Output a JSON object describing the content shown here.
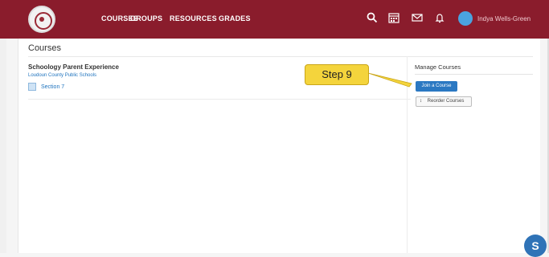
{
  "topbar": {
    "nav": [
      "COURSES",
      "GROUPS",
      "RESOURCES",
      "GRADES"
    ],
    "user_name": "Indya Wells-Green",
    "icons": [
      "search-icon",
      "calendar-icon",
      "mail-icon",
      "notifications-icon"
    ]
  },
  "page": {
    "title": "Courses"
  },
  "course": {
    "name": "Schoology Parent Experience",
    "school": "Loudoun County Public Schools",
    "section": "Section 7"
  },
  "manage": {
    "title": "Manage Courses",
    "join_label": "Join a Course",
    "reorder_label": "Reorder Courses"
  },
  "annotation": {
    "step_label": "Step 9"
  },
  "help_fab": {
    "label": "S"
  },
  "colors": {
    "brand": "#8a1c2c",
    "accent": "#2b78c2",
    "callout": "#f4d43c"
  }
}
